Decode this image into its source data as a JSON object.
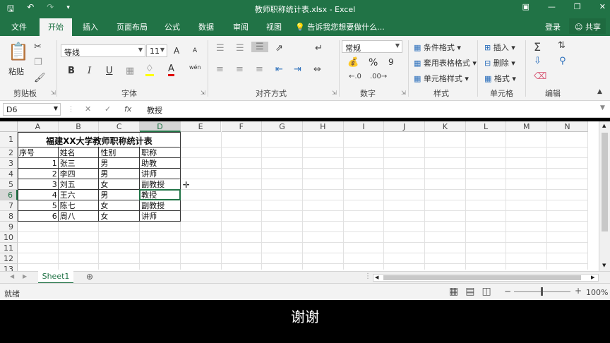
{
  "window": {
    "title": "教师职称统计表.xlsx - Excel",
    "qat_icons": [
      "save-icon",
      "undo-icon",
      "redo-icon",
      "customize-icon"
    ],
    "controls": [
      "ribbon-display-icon",
      "minimize-icon",
      "restore-icon",
      "close-icon"
    ]
  },
  "tabs": {
    "file": "文件",
    "home": "开始",
    "insert": "插入",
    "page_layout": "页面布局",
    "formulas": "公式",
    "data": "数据",
    "review": "审阅",
    "view": "视图",
    "tell_me": "告诉我您想要做什么...",
    "login": "登录",
    "share": "共享"
  },
  "ribbon": {
    "clipboard": {
      "label": "剪贴板",
      "paste": "粘贴"
    },
    "font": {
      "label": "字体",
      "name": "等线",
      "size": "11",
      "bold": "B",
      "italic": "I",
      "underline": "U",
      "grow": "A",
      "shrink": "A",
      "phonetic": "wén"
    },
    "alignment": {
      "label": "对齐方式"
    },
    "number": {
      "label": "数字",
      "format": "常规",
      "percent": "%",
      "comma": "9"
    },
    "styles": {
      "label": "样式",
      "conditional": "条件格式",
      "table": "套用表格格式",
      "cell": "单元格样式"
    },
    "cells": {
      "label": "单元格",
      "insert": "插入",
      "delete": "删除",
      "format": "格式"
    },
    "editing": {
      "label": "编辑"
    }
  },
  "formula_bar": {
    "name_box": "D6",
    "content": "教授"
  },
  "grid": {
    "columns": [
      "A",
      "B",
      "C",
      "D",
      "E",
      "F",
      "G",
      "H",
      "I",
      "J",
      "K",
      "L",
      "M",
      "N"
    ],
    "rows": [
      "1",
      "2",
      "3",
      "4",
      "5",
      "6",
      "7",
      "8",
      "9",
      "10",
      "11",
      "12",
      "13"
    ],
    "title": "福建XX大学教师职称统计表",
    "headers": [
      "序号",
      "姓名",
      "性别",
      "职称"
    ],
    "records": [
      {
        "id": "1",
        "name": "张三",
        "gender": "男",
        "title": "助教"
      },
      {
        "id": "2",
        "name": "李四",
        "gender": "男",
        "title": "讲师"
      },
      {
        "id": "3",
        "name": "刘五",
        "gender": "女",
        "title": "副教授"
      },
      {
        "id": "4",
        "name": "王六",
        "gender": "男",
        "title": "教授"
      },
      {
        "id": "5",
        "name": "陈七",
        "gender": "女",
        "title": "副教授"
      },
      {
        "id": "6",
        "name": "周八",
        "gender": "女",
        "title": "讲师"
      }
    ]
  },
  "sheets": {
    "active": "Sheet1"
  },
  "status": {
    "ready": "就绪",
    "zoom": "100%"
  },
  "subtitle": "谢谢"
}
